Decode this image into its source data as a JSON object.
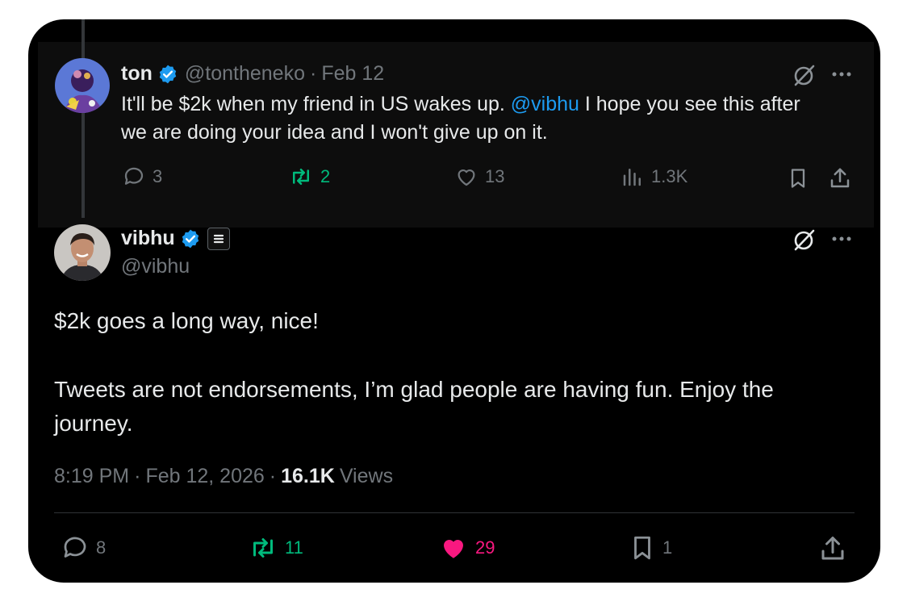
{
  "parent_tweet": {
    "display_name": "ton",
    "handle": "@tontheneko",
    "separator": "·",
    "date": "Feb 12",
    "text_before_mention": "It'll be $2k when my friend in US wakes up. ",
    "mention": "@vibhu",
    "text_after_mention_line1": " I hope you see this after",
    "text_line2": "we are doing your idea and I won't give up on it.",
    "replies": "3",
    "reposts": "2",
    "likes": "13",
    "views": "1.3K"
  },
  "main_tweet": {
    "display_name": "vibhu",
    "handle": "@vibhu",
    "paragraph1": "$2k goes a long way, nice!",
    "paragraph2": "Tweets are not endorsements, I’m glad people are having fun. Enjoy the journey.",
    "time": "8:19 PM",
    "separator": "·",
    "date": "Feb 12, 2026",
    "views_count": "16.1K",
    "views_label": "Views",
    "replies": "8",
    "reposts": "11",
    "likes": "29",
    "bookmarks": "1"
  },
  "colors": {
    "background": "#000000",
    "text": "#e7e9ea",
    "muted": "#71767b",
    "link": "#1d9bf0",
    "repost_green": "#00ba7c",
    "like_pink": "#f91880",
    "verified_blue": "#1d9bf0"
  },
  "icons": [
    "verified-icon",
    "grok-icon",
    "more-icon",
    "reply-icon",
    "repost-icon",
    "like-icon",
    "views-icon",
    "bookmark-icon",
    "share-icon",
    "subscription-badge-icon"
  ]
}
